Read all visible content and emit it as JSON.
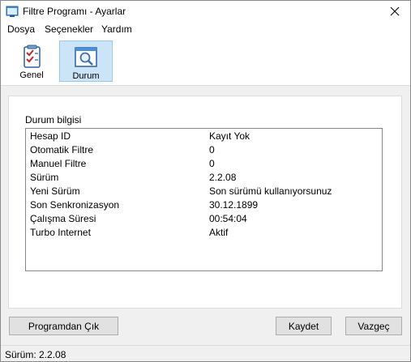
{
  "window": {
    "title": "Filtre Programı - Ayarlar"
  },
  "menu": [
    "Dosya",
    "Seçenekler",
    "Yardım"
  ],
  "toolbar": {
    "items": [
      {
        "label": "Genel",
        "icon": "checklist-icon",
        "selected": false
      },
      {
        "label": "Durum",
        "icon": "magnifier-window-icon",
        "selected": true
      }
    ]
  },
  "status_panel": {
    "group_label": "Durum bilgisi",
    "rows": [
      {
        "key": "Hesap ID",
        "value": "Kayıt Yok"
      },
      {
        "key": "Otomatik Filtre",
        "value": "0"
      },
      {
        "key": "Manuel Filtre",
        "value": "0"
      },
      {
        "key": "Sürüm",
        "value": "2.2.08"
      },
      {
        "key": "Yeni Sürüm",
        "value": "Son sürümü kullanıyorsunuz"
      },
      {
        "key": "Son Senkronizasyon",
        "value": "30.12.1899"
      },
      {
        "key": "Çalışma Süresi",
        "value": "00:54:04"
      },
      {
        "key": "Turbo Internet",
        "value": "Aktif"
      }
    ]
  },
  "buttons": {
    "exit": "Programdan Çık",
    "save": "Kaydet",
    "cancel": "Vazgeç"
  },
  "statusbar": {
    "text": "Sürüm: 2.2.08"
  },
  "colors": {
    "selected_tab_bg": "#cce4f7",
    "selected_tab_border": "#99c9ef",
    "window_bg": "#f0f0f0"
  }
}
